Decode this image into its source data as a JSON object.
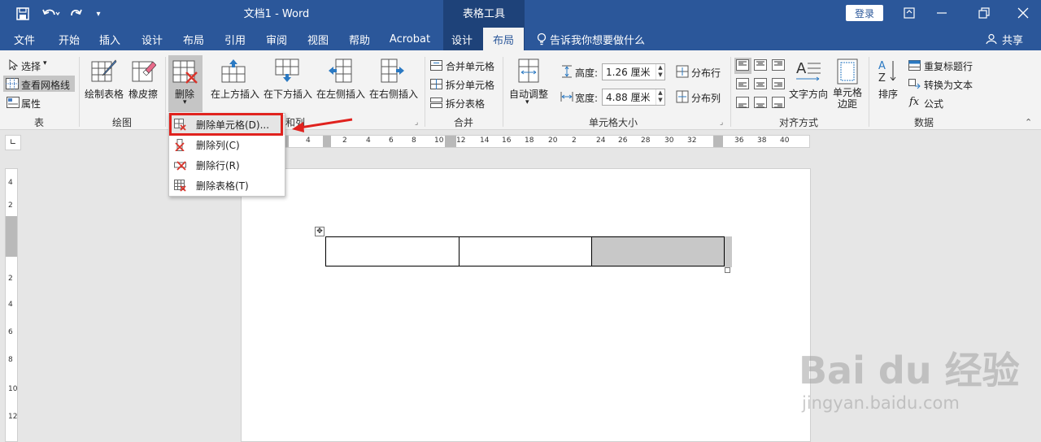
{
  "titlebar": {
    "doc_title": "文档1  -  Word",
    "context_tools": "表格工具",
    "login": "登录",
    "share": "共享",
    "tell_me": "告诉我你想要做什么"
  },
  "tabs": [
    "文件",
    "开始",
    "插入",
    "设计",
    "布局",
    "引用",
    "审阅",
    "视图",
    "帮助",
    "Acrobat",
    "设计",
    "布局"
  ],
  "ribbon": {
    "table_group": {
      "select": "选择",
      "view_gridlines": "查看网格线",
      "properties": "属性",
      "label": "表"
    },
    "draw_group": {
      "draw_table": "绘制表格",
      "eraser": "橡皮擦",
      "label": "绘图"
    },
    "delete_button": "删除",
    "rows_cols_group": {
      "insert_above": "在上方插入",
      "insert_below": "在下方插入",
      "insert_left": "在左侧插入",
      "insert_right": "在右侧插入",
      "label_partial": "和列"
    },
    "merge_group": {
      "merge_cells": "合并单元格",
      "split_cells": "拆分单元格",
      "split_table": "拆分表格",
      "label": "合并"
    },
    "cell_size_group": {
      "autofit": "自动调整",
      "height_label": "高度:",
      "height_value": "1.26 厘米",
      "width_label": "宽度:",
      "width_value": "4.88 厘米",
      "distribute_rows": "分布行",
      "distribute_cols": "分布列",
      "label": "单元格大小"
    },
    "alignment_group": {
      "text_direction": "文字方向",
      "cell_margins": "单元格\n边距",
      "label": "对齐方式"
    },
    "data_group": {
      "sort": "排序",
      "repeat_header": "重复标题行",
      "convert_to_text": "转换为文本",
      "formula": "公式",
      "label": "数据"
    }
  },
  "delete_menu": [
    {
      "label": "删除单元格(D)...",
      "icon": "delete-cells-icon"
    },
    {
      "label": "删除列(C)",
      "icon": "delete-columns-icon"
    },
    {
      "label": "删除行(R)",
      "icon": "delete-rows-icon"
    },
    {
      "label": "删除表格(T)",
      "icon": "delete-table-icon"
    }
  ],
  "ruler": {
    "h_ticks": [
      "4",
      "2",
      "2",
      "4",
      "6",
      "8",
      "10",
      "12",
      "14",
      "16",
      "18",
      "20",
      "2",
      "24",
      "26",
      "28",
      "30",
      "32",
      "36",
      "38",
      "40"
    ],
    "v_ticks": [
      "4",
      "2",
      "2",
      "4",
      "6",
      "8",
      "10",
      "12"
    ]
  },
  "watermark": {
    "brand": "Bai du 经验",
    "url": "jingyan.baidu.com"
  },
  "colors": {
    "word_blue": "#2b579a",
    "context_band": "#1e4279",
    "highlight_red": "#e0221e",
    "shaded_cell": "#c8c8c8"
  }
}
